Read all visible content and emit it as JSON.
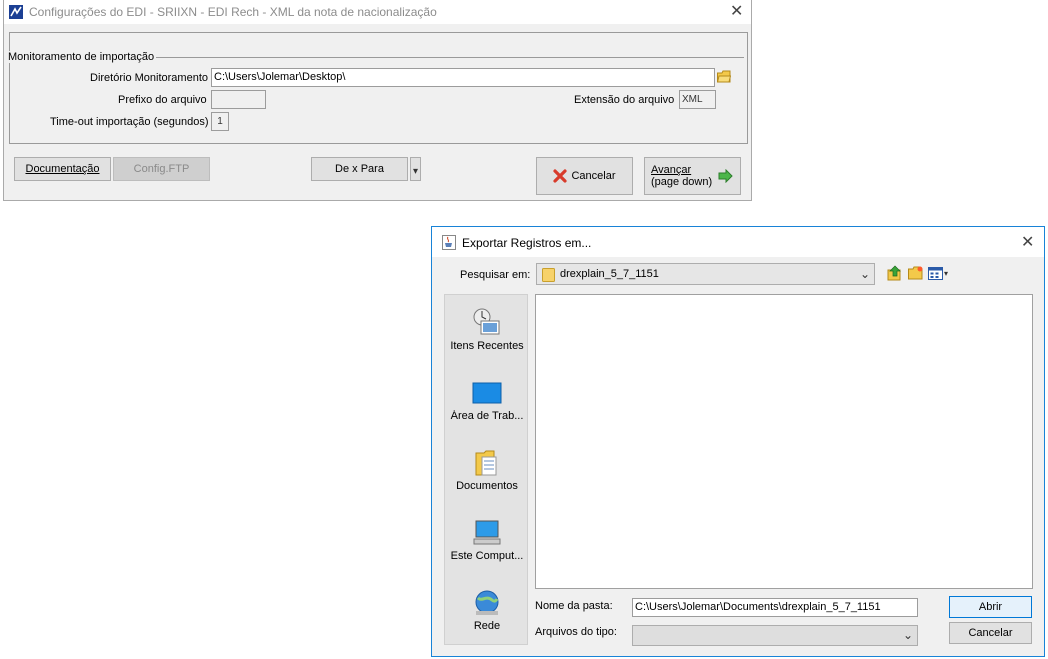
{
  "edi_window": {
    "title": "Configurações do EDI - SRIIXN - EDI Rech - XML da nota de nacionalização",
    "group_title": "Monitoramento de importação",
    "fields": {
      "dir_label": "Diretório Monitoramento",
      "dir_value": "C:\\Users\\Jolemar\\Desktop\\",
      "prefix_label": "Prefixo do arquivo",
      "prefix_value": "",
      "ext_label": "Extensão do arquivo",
      "ext_value": "XML",
      "timeout_label": "Time-out importação (segundos)",
      "timeout_value": "1"
    },
    "buttons": {
      "documentacao": "Documentação",
      "config_ftp": "Config.FTP",
      "de_para": "De x Para",
      "cancelar": "Cancelar",
      "avancar_line1": "Avançar",
      "avancar_line2": "(page down)"
    }
  },
  "chooser_window": {
    "title": "Exportar Registros em...",
    "look_in_label": "Pesquisar em:",
    "look_in_value": "drexplain_5_7_1151",
    "places": [
      {
        "label": "Itens Recentes",
        "icon": "recent-items-icon"
      },
      {
        "label": "Área de Trab...",
        "icon": "desktop-icon"
      },
      {
        "label": "Documentos",
        "icon": "documents-icon"
      },
      {
        "label": "Este Comput...",
        "icon": "computer-icon"
      },
      {
        "label": "Rede",
        "icon": "network-icon"
      }
    ],
    "folder_name_label": "Nome da pasta:",
    "folder_name_value": "C:\\Users\\Jolemar\\Documents\\drexplain_5_7_1151",
    "file_type_label": "Arquivos do tipo:",
    "file_type_value": "",
    "open_button": "Abrir",
    "cancel_button": "Cancelar"
  },
  "colors": {
    "accent_border": "#1883d7",
    "window_bg": "#f0f0f0"
  }
}
